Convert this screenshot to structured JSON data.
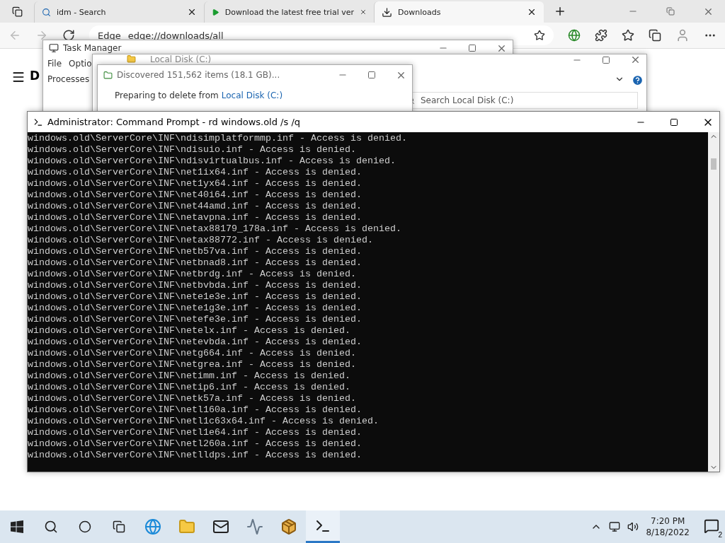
{
  "browser": {
    "tabs": [
      {
        "label": "idm - Search",
        "selected": false
      },
      {
        "label": "Download the latest free trial ver",
        "selected": false
      },
      {
        "label": "Downloads",
        "selected": true
      }
    ],
    "address_prefix": "Edge",
    "address": "edge://downloads/all",
    "page_heading": "D"
  },
  "task_manager": {
    "title": "Task Manager",
    "menu": [
      "File",
      "Optio"
    ],
    "tab": "Processes"
  },
  "explorer": {
    "title": "Local Disk (C:)",
    "search_placeholder": "Search Local Disk (C:)"
  },
  "delete_dialog": {
    "title": "Discovered 151,562 items (18.1 GB)...",
    "text": "Preparing to delete from",
    "location": "Local Disk (C:)"
  },
  "cmd": {
    "title": "Administrator: Command Prompt - rd  windows.old /s /q",
    "lines": [
      "windows.old\\ServerCore\\INF\\ndisimplatformmp.inf - Access is denied.",
      "windows.old\\ServerCore\\INF\\ndisuio.inf - Access is denied.",
      "windows.old\\ServerCore\\INF\\ndisvirtualbus.inf - Access is denied.",
      "windows.old\\ServerCore\\INF\\net1ix64.inf - Access is denied.",
      "windows.old\\ServerCore\\INF\\net1yx64.inf - Access is denied.",
      "windows.old\\ServerCore\\INF\\net40i64.inf - Access is denied.",
      "windows.old\\ServerCore\\INF\\net44amd.inf - Access is denied.",
      "windows.old\\ServerCore\\INF\\netavpna.inf - Access is denied.",
      "windows.old\\ServerCore\\INF\\netax88179_178a.inf - Access is denied.",
      "windows.old\\ServerCore\\INF\\netax88772.inf - Access is denied.",
      "windows.old\\ServerCore\\INF\\netb57va.inf - Access is denied.",
      "windows.old\\ServerCore\\INF\\netbnad8.inf - Access is denied.",
      "windows.old\\ServerCore\\INF\\netbrdg.inf - Access is denied.",
      "windows.old\\ServerCore\\INF\\netbvbda.inf - Access is denied.",
      "windows.old\\ServerCore\\INF\\nete1e3e.inf - Access is denied.",
      "windows.old\\ServerCore\\INF\\nete1g3e.inf - Access is denied.",
      "windows.old\\ServerCore\\INF\\netefe3e.inf - Access is denied.",
      "windows.old\\ServerCore\\INF\\netelx.inf - Access is denied.",
      "windows.old\\ServerCore\\INF\\netevbda.inf - Access is denied.",
      "windows.old\\ServerCore\\INF\\netg664.inf - Access is denied.",
      "windows.old\\ServerCore\\INF\\netgrea.inf - Access is denied.",
      "windows.old\\ServerCore\\INF\\netimm.inf - Access is denied.",
      "windows.old\\ServerCore\\INF\\netip6.inf - Access is denied.",
      "windows.old\\ServerCore\\INF\\netk57a.inf - Access is denied.",
      "windows.old\\ServerCore\\INF\\netl160a.inf - Access is denied.",
      "windows.old\\ServerCore\\INF\\netl1c63x64.inf - Access is denied.",
      "windows.old\\ServerCore\\INF\\netl1e64.inf - Access is denied.",
      "windows.old\\ServerCore\\INF\\netl260a.inf - Access is denied.",
      "windows.old\\ServerCore\\INF\\netlldps.inf - Access is denied."
    ]
  },
  "taskbar": {
    "apps": [
      {
        "kind": "edge",
        "selected": false
      },
      {
        "kind": "folder",
        "selected": false
      },
      {
        "kind": "mail",
        "selected": false
      },
      {
        "kind": "monitor",
        "selected": false
      },
      {
        "kind": "archive",
        "selected": false
      },
      {
        "kind": "cmd",
        "selected": true
      }
    ],
    "time": "7:20 PM",
    "date": "8/18/2022",
    "notifications": "2"
  }
}
